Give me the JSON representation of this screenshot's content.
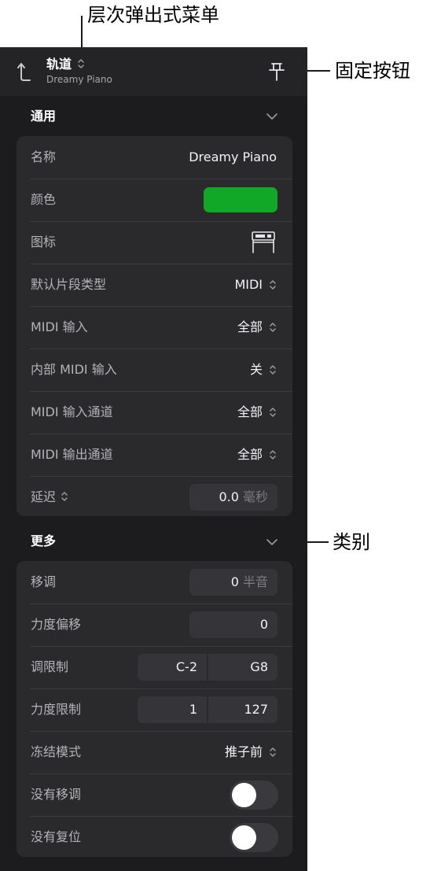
{
  "callouts": {
    "hierarchy_menu": "层次弹出式菜单",
    "pin_button": "固定按钮",
    "category": "类别"
  },
  "header": {
    "title": "轨道",
    "subtitle": "Dreamy Piano",
    "icons": [
      "back-arrow-icon",
      "up-down-chevron-icon",
      "pin-icon"
    ]
  },
  "general": {
    "title": "通用",
    "name_label": "名称",
    "name_value": "Dreamy Piano",
    "color_label": "颜色",
    "color_value": "#12a827",
    "icon_label": "图标",
    "icon_value": "piano-icon",
    "region_type_label": "默认片段类型",
    "region_type_value": "MIDI",
    "midi_in_label": "MIDI 输入",
    "midi_in_value": "全部",
    "internal_midi_label": "内部 MIDI 输入",
    "internal_midi_value": "关",
    "midi_in_channel_label": "MIDI 输入通道",
    "midi_in_channel_value": "全部",
    "midi_out_channel_label": "MIDI 输出通道",
    "midi_out_channel_value": "全部",
    "delay_label": "延迟",
    "delay_value": "0.0",
    "delay_unit": "毫秒"
  },
  "more": {
    "title": "更多",
    "transpose_label": "移调",
    "transpose_value": "0",
    "transpose_unit": "半音",
    "velocity_offset_label": "力度偏移",
    "velocity_offset_value": "0",
    "key_limit_label": "调限制",
    "key_limit_low": "C-2",
    "key_limit_high": "G8",
    "velocity_limit_label": "力度限制",
    "velocity_limit_low": "1",
    "velocity_limit_high": "127",
    "freeze_mode_label": "冻结模式",
    "freeze_mode_value": "推子前",
    "no_transpose_label": "没有移调",
    "no_transpose_on": false,
    "no_reset_label": "没有复位",
    "no_reset_on": false
  }
}
